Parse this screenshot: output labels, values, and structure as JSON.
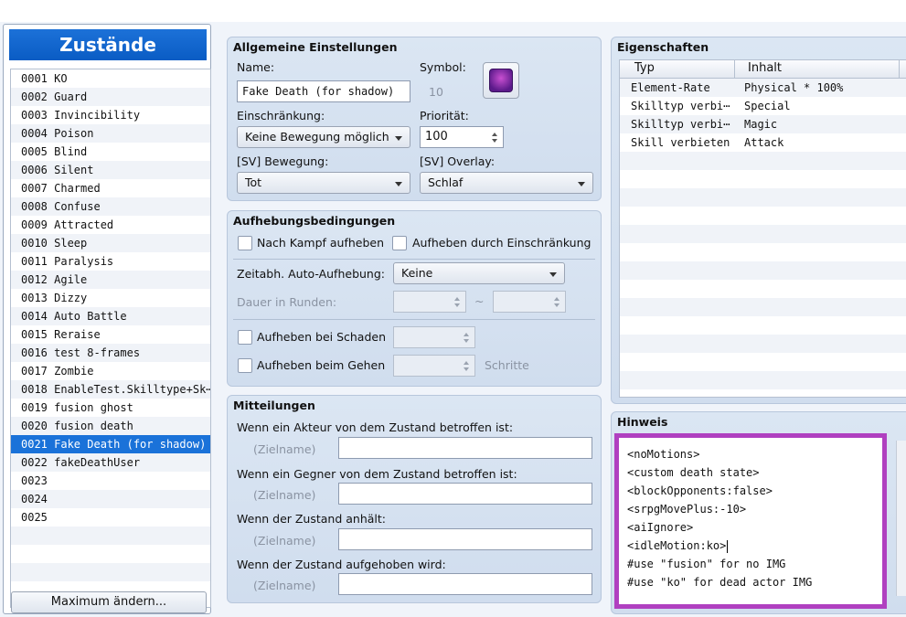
{
  "states_panel": {
    "title": "Zustände",
    "items": [
      "0001 KO",
      "0002 Guard",
      "0003 Invincibility",
      "0004 Poison",
      "0005 Blind",
      "0006 Silent",
      "0007 Charmed",
      "0008 Confuse",
      "0009 Attracted",
      "0010 Sleep",
      "0011 Paralysis",
      "0012 Agile",
      "0013 Dizzy",
      "0014 Auto Battle",
      "0015 Reraise",
      "0016 test 8-frames",
      "0017 Zombie",
      "0018 EnableTest.Skilltype+Sk⋯",
      "0019 fusion ghost",
      "0020 fusion death",
      "0021 Fake Death (for shadow)",
      "0022 fakeDeathUser",
      "0023",
      "0024",
      "0025",
      "",
      "",
      "",
      ""
    ],
    "selected_index": 20,
    "max_button": "Maximum ändern..."
  },
  "general": {
    "title": "Allgemeine Einstellungen",
    "name_label": "Name:",
    "name_value": "Fake Death (for shadow)",
    "symbol_label": "Symbol:",
    "symbol_value": "10",
    "restriction_label": "Einschränkung:",
    "restriction_value": "Keine Bewegung möglich",
    "priority_label": "Priorität:",
    "priority_value": "100",
    "sv_motion_label": "[SV] Bewegung:",
    "sv_motion_value": "Tot",
    "sv_overlay_label": "[SV] Overlay:",
    "sv_overlay_value": "Schlaf"
  },
  "removal": {
    "title": "Aufhebungsbedingungen",
    "after_battle": "Nach Kampf aufheben",
    "by_restriction": "Aufheben durch Einschränkung",
    "auto_removal_label": "Zeitabh. Auto-Aufhebung:",
    "auto_removal_value": "Keine",
    "duration_label": "Dauer in Runden:",
    "tilde": "~",
    "by_damage": "Aufheben bei Schaden",
    "by_walking": "Aufheben beim Gehen",
    "steps_label": "Schritte"
  },
  "messages": {
    "title": "Mitteilungen",
    "actor_label": "Wenn ein Akteur von dem Zustand betroffen ist:",
    "enemy_label": "Wenn ein Gegner von dem Zustand betroffen ist:",
    "persist_label": "Wenn der Zustand anhält:",
    "removed_label": "Wenn der Zustand aufgehoben wird:",
    "target_placeholder": "(Zielname)"
  },
  "traits": {
    "title": "Eigenschaften",
    "col_type": "Typ",
    "col_content": "Inhalt",
    "rows": [
      {
        "type": "Element-Rate",
        "content": "Physical * 100%"
      },
      {
        "type": "Skilltyp verbi⋯",
        "content": "Special"
      },
      {
        "type": "Skilltyp verbi⋯",
        "content": "Magic"
      },
      {
        "type": "Skill verbieten",
        "content": "Attack"
      }
    ]
  },
  "note": {
    "title": "Hinweis",
    "lines": [
      "<noMotions>",
      "<custom death state>",
      "<blockOpponents:false>",
      "<srpgMovePlus:-10>",
      "<aiIgnore>",
      "<idleMotion:ko>",
      "#use \"fusion\" for no IMG",
      "#use \"ko\" for dead actor IMG"
    ],
    "highlight_color": "#b040c0"
  }
}
